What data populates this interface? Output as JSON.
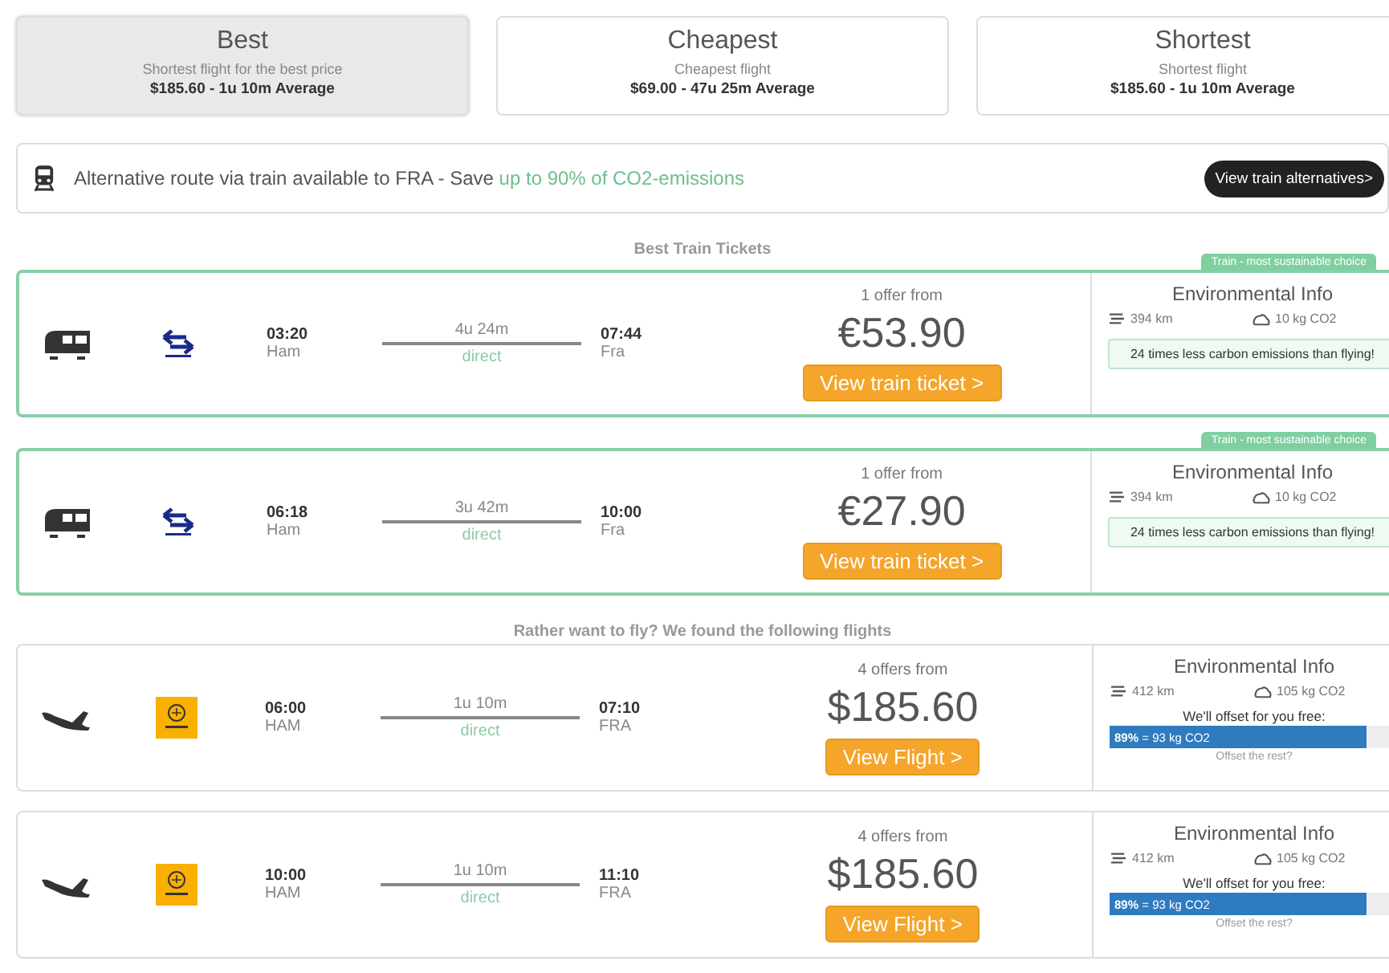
{
  "sort_tabs": [
    {
      "title": "Best",
      "subtitle": "Shortest flight for the best price",
      "summary": "$185.60 - 1u 10m Average",
      "selected": true
    },
    {
      "title": "Cheapest",
      "subtitle": "Cheapest flight",
      "summary": "$69.00 - 47u 25m Average",
      "selected": false
    },
    {
      "title": "Shortest",
      "subtitle": "Shortest flight",
      "summary": "$185.60 - 1u 10m Average",
      "selected": false
    }
  ],
  "train_banner": {
    "text": "Alternative route via train available to FRA - Save ",
    "highlight": "up to 90% of CO2-emissions",
    "button": "View train alternatives>"
  },
  "sections": [
    {
      "heading": "Best Train Tickets",
      "results": [
        {
          "kind": "train",
          "badge": "Train - most sustainable choice",
          "departure_time": "03:20",
          "departure_place": "Ham",
          "duration": "4u 24m",
          "stops": "direct",
          "arrival_time": "07:44",
          "arrival_place": "Fra",
          "offers": "1 offer from",
          "price": "€53.90",
          "button": "View train ticket >",
          "env_title": "Environmental Info",
          "distance": "394 km",
          "co2": "10 kg CO2",
          "note": "24 times less carbon emissions than flying!"
        },
        {
          "kind": "train",
          "badge": "Train - most sustainable choice",
          "departure_time": "06:18",
          "departure_place": "Ham",
          "duration": "3u 42m",
          "stops": "direct",
          "arrival_time": "10:00",
          "arrival_place": "Fra",
          "offers": "1 offer from",
          "price": "€27.90",
          "button": "View train ticket >",
          "env_title": "Environmental Info",
          "distance": "394 km",
          "co2": "10 kg CO2",
          "note": "24 times less carbon emissions than flying!"
        }
      ]
    },
    {
      "heading": "Rather want to fly? We found the following flights",
      "results": [
        {
          "kind": "flight",
          "departure_time": "06:00",
          "departure_place": "HAM",
          "duration": "1u 10m",
          "stops": "direct",
          "arrival_time": "07:10",
          "arrival_place": "FRA",
          "offers": "4 offers from",
          "price": "$185.60",
          "button": "View Flight >",
          "env_title": "Environmental Info",
          "distance": "412 km",
          "co2": "105 kg CO2",
          "offset": {
            "title": "We'll offset for you free:",
            "label": "**89%** = 93 kg CO2",
            "level": 0.89,
            "link": "Offset the rest?"
          }
        },
        {
          "kind": "flight",
          "departure_time": "10:00",
          "departure_place": "HAM",
          "duration": "1u 10m",
          "stops": "direct",
          "arrival_time": "11:10",
          "arrival_place": "FRA",
          "offers": "4 offers from",
          "price": "$185.60",
          "button": "View Flight >",
          "env_title": "Environmental Info",
          "distance": "412 km",
          "co2": "105 kg CO2",
          "offset": {
            "title": "We'll offset for you free:",
            "label": "**89%** = 93 kg CO2",
            "level": 0.89,
            "link": "Offset the rest?"
          }
        }
      ]
    }
  ]
}
